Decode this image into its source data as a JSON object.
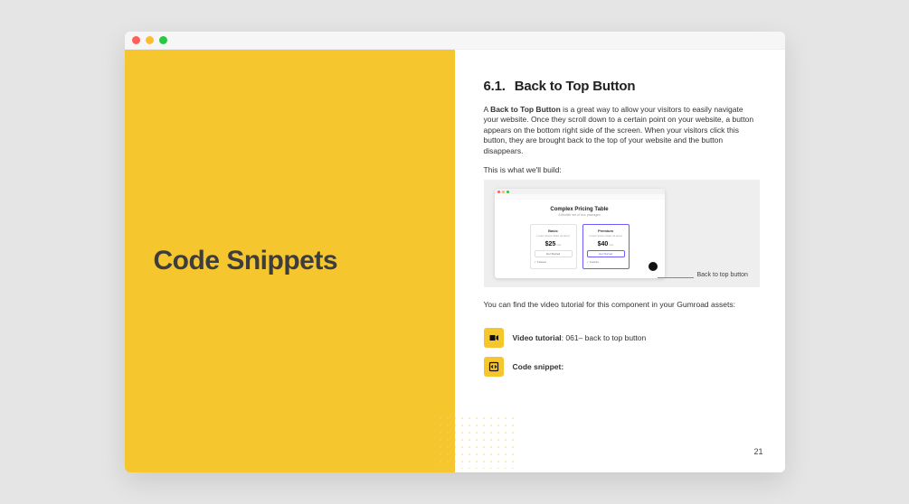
{
  "left": {
    "title": "Code Snippets"
  },
  "right": {
    "heading_number": "6.1.",
    "heading_text": "Back to Top Button",
    "intro_prefix": "A ",
    "intro_bold": "Back to Top Button",
    "intro_rest": " is a great way to allow your visitors to easily navigate your website. Once they scroll down to a certain point on your website, a button appears on the bottom right side of the screen. When your visitors click this button, they are brought back to the top of your website and the button disappears.",
    "build_label": "This is what we'll build:",
    "callout_label": "Back to top button",
    "gumroad_line": "You can find the video tutorial for this component in your Gumroad assets:",
    "video_label": "Video tutorial",
    "video_value": ": 061– back to top button",
    "code_label": "Code snippet:",
    "page_number": "21"
  },
  "preview": {
    "title": "Complex Pricing Table",
    "subtitle": "A flexible set of four packages",
    "cards": [
      {
        "plan": "Basic",
        "desc": "Lorem ipsum dolor sit amet",
        "price": "$25",
        "unit": "/mo",
        "cta": "Get Started",
        "feature": "Feature"
      },
      {
        "plan": "Premium",
        "desc": "Lorem ipsum dolor sit amet",
        "price": "$40",
        "unit": "/mo",
        "cta": "Get Started",
        "feature": "Feature"
      }
    ]
  }
}
